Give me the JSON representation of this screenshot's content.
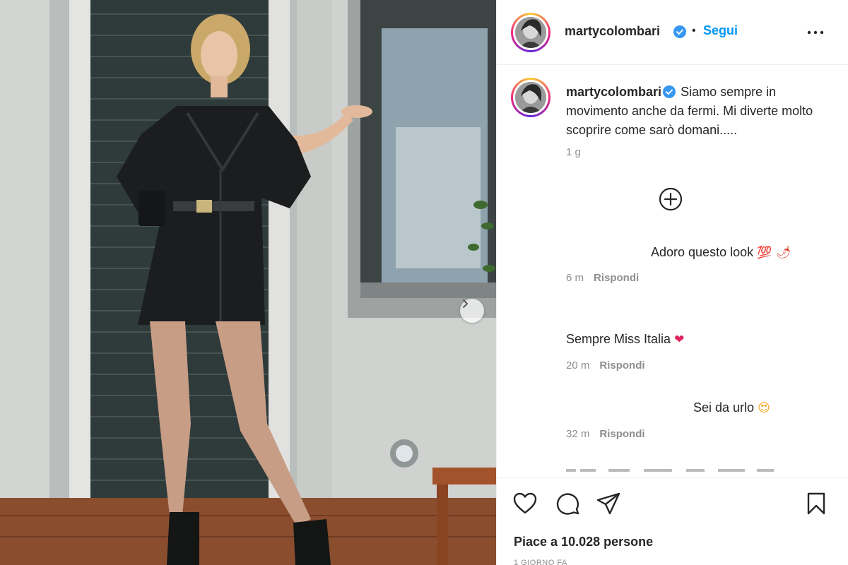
{
  "post": {
    "username": "martycolombari",
    "follow_label": "Segui",
    "dot": "•",
    "caption": "Siamo sempre in movimento anche da fermi. Mi diverte molto scoprire come sarò domani.....",
    "caption_time": "1 g"
  },
  "comments": [
    {
      "text": "Adoro questo look",
      "emoji": "💯 🌶",
      "time": "6 m",
      "reply": "Rispondi"
    },
    {
      "text": "Sempre Miss Italia",
      "emoji": "❤",
      "time": "20 m",
      "reply": "Rispondi"
    },
    {
      "text": "Sei da urlo",
      "emoji": "😍",
      "time": "32 m",
      "reply": "Rispondi"
    }
  ],
  "footer": {
    "likes": "Piace a 10.028 persone",
    "date": "1 GIORNO FA"
  },
  "icons": {
    "verified": "verified-badge-icon",
    "more": "more-options-icon",
    "load_more": "plus-circle-icon",
    "like": "heart-icon",
    "comment": "comment-bubble-icon",
    "share": "paper-plane-icon",
    "save": "bookmark-icon",
    "next": "chevron-right-icon"
  },
  "colors": {
    "accent": "#0095f6",
    "verified": "#3897f0",
    "text": "#262626",
    "muted": "#8e8e8e",
    "heart": "#e0245e"
  }
}
